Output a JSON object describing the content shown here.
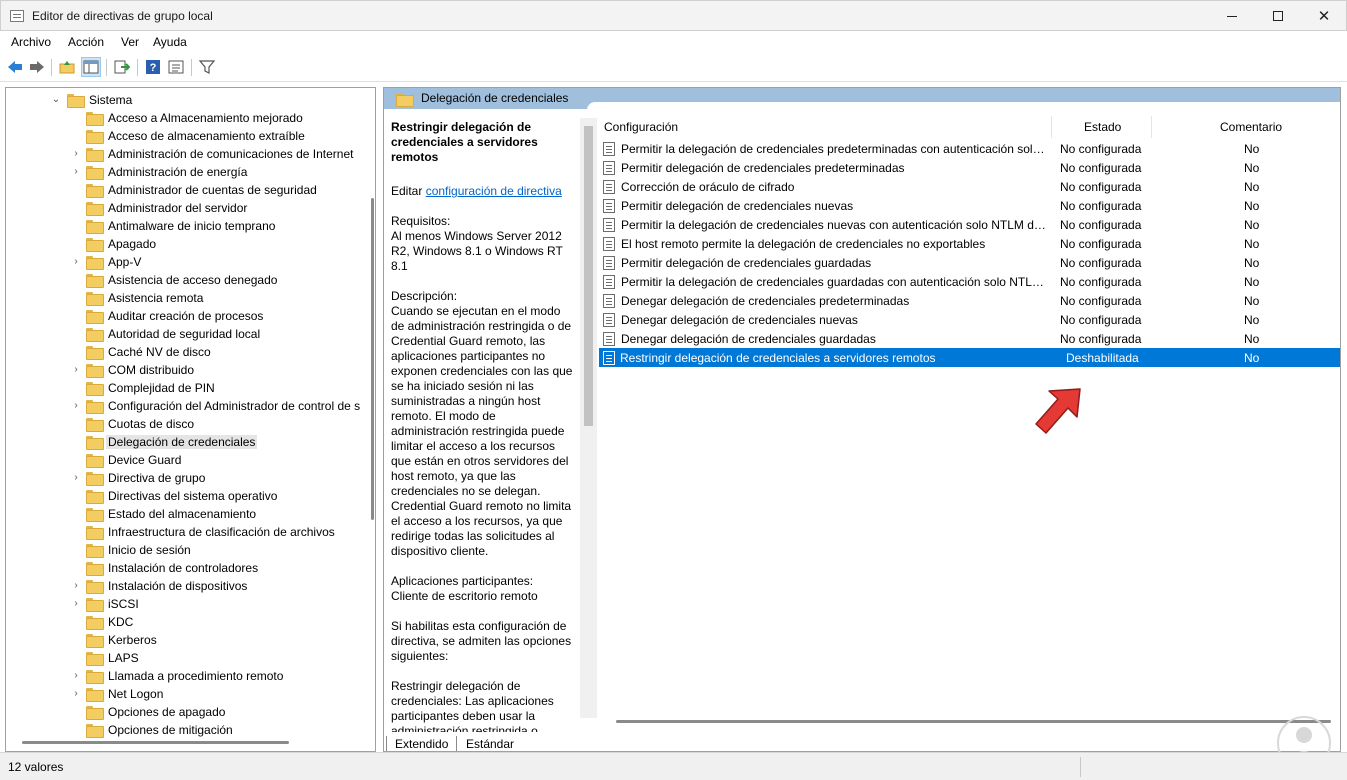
{
  "window": {
    "title": "Editor de directivas de grupo local"
  },
  "menu": [
    "Archivo",
    "Acción",
    "Ver",
    "Ayuda"
  ],
  "toolbar": {
    "buttons": [
      "back-icon",
      "forward-icon",
      "up-folder-icon",
      "show-hide-tree-icon",
      "export-list-icon",
      "help-icon",
      "properties-icon",
      "filter-icon"
    ]
  },
  "tree": {
    "root": "Sistema",
    "items": [
      {
        "label": "Acceso a Almacenamiento mejorado",
        "expandable": false
      },
      {
        "label": "Acceso de almacenamiento extraíble",
        "expandable": false
      },
      {
        "label": "Administración de comunicaciones de Internet",
        "expandable": true
      },
      {
        "label": "Administración de energía",
        "expandable": true
      },
      {
        "label": "Administrador de cuentas de seguridad",
        "expandable": false
      },
      {
        "label": "Administrador del servidor",
        "expandable": false
      },
      {
        "label": "Antimalware de inicio temprano",
        "expandable": false
      },
      {
        "label": "Apagado",
        "expandable": false
      },
      {
        "label": "App-V",
        "expandable": true
      },
      {
        "label": "Asistencia de acceso denegado",
        "expandable": false
      },
      {
        "label": "Asistencia remota",
        "expandable": false
      },
      {
        "label": "Auditar creación de procesos",
        "expandable": false
      },
      {
        "label": "Autoridad de seguridad local",
        "expandable": false
      },
      {
        "label": "Caché NV de disco",
        "expandable": false
      },
      {
        "label": "COM distribuido",
        "expandable": true
      },
      {
        "label": "Complejidad de PIN",
        "expandable": false
      },
      {
        "label": "Configuración del Administrador de control de s",
        "expandable": true
      },
      {
        "label": "Cuotas de disco",
        "expandable": false
      },
      {
        "label": "Delegación de credenciales",
        "expandable": false,
        "selected": true
      },
      {
        "label": "Device Guard",
        "expandable": false
      },
      {
        "label": "Directiva de grupo",
        "expandable": true
      },
      {
        "label": "Directivas del sistema operativo",
        "expandable": false
      },
      {
        "label": "Estado del almacenamiento",
        "expandable": false
      },
      {
        "label": "Infraestructura de clasificación de archivos",
        "expandable": false
      },
      {
        "label": "Inicio de sesión",
        "expandable": false
      },
      {
        "label": "Instalación de controladores",
        "expandable": false
      },
      {
        "label": "Instalación de dispositivos",
        "expandable": true
      },
      {
        "label": "iSCSI",
        "expandable": true
      },
      {
        "label": "KDC",
        "expandable": false
      },
      {
        "label": "Kerberos",
        "expandable": false
      },
      {
        "label": "LAPS",
        "expandable": false
      },
      {
        "label": "Llamada a procedimiento remoto",
        "expandable": true
      },
      {
        "label": "Net Logon",
        "expandable": true
      },
      {
        "label": "Opciones de apagado",
        "expandable": false
      },
      {
        "label": "Opciones de mitigación",
        "expandable": false
      }
    ]
  },
  "panel": {
    "header": "Delegación de credenciales",
    "description": {
      "title": "Restringir delegación de credenciales a servidores remotos",
      "edit_prefix": "Editar ",
      "edit_link": "configuración de directiva",
      "requirements_label": "Requisitos:",
      "requirements": "Al menos Windows Server 2012 R2, Windows 8.1 o Windows RT 8.1",
      "description_label": "Descripción:",
      "description": "Cuando se ejecutan en el modo de administración restringida o de Credential Guard remoto, las aplicaciones participantes no exponen credenciales con las que se ha iniciado sesión ni las suministradas a ningún host remoto. El modo de administración restringida puede limitar el acceso a los recursos que están en otros servidores del host remoto, ya que las credenciales no se delegan. Credential Guard remoto no limita el acceso a los recursos, ya que redirige todas las solicitudes al dispositivo cliente.",
      "apps_label": "Aplicaciones participantes:",
      "apps": "Cliente de escritorio remoto",
      "options_intro": "Si habilitas esta configuración de directiva, se admiten las opciones siguientes:",
      "option_1": "Restringir delegación de credenciales: Las aplicaciones participantes deben usar la administración restringida o Credential Guard remoto para conectarse a los hosts remotos."
    },
    "tabs": [
      "Extendido",
      "Estándar"
    ],
    "columns": [
      "Configuración",
      "Estado",
      "Comentario"
    ],
    "rows": [
      {
        "setting": "Permitir la delegación de credenciales predeterminadas con autenticación solo NTLM de servidor",
        "state": "No configurada",
        "comment": "No"
      },
      {
        "setting": "Permitir delegación de credenciales predeterminadas",
        "state": "No configurada",
        "comment": "No"
      },
      {
        "setting": "Corrección de oráculo de cifrado",
        "state": "No configurada",
        "comment": "No"
      },
      {
        "setting": "Permitir delegación de credenciales nuevas",
        "state": "No configurada",
        "comment": "No"
      },
      {
        "setting": "Permitir la delegación de credenciales nuevas con autenticación solo NTLM de servidor",
        "state": "No configurada",
        "comment": "No"
      },
      {
        "setting": "El host remoto permite la delegación de credenciales no exportables",
        "state": "No configurada",
        "comment": "No"
      },
      {
        "setting": "Permitir delegación de credenciales guardadas",
        "state": "No configurada",
        "comment": "No"
      },
      {
        "setting": "Permitir la delegación de credenciales guardadas con autenticación solo NTLM de servidor",
        "state": "No configurada",
        "comment": "No"
      },
      {
        "setting": "Denegar delegación de credenciales predeterminadas",
        "state": "No configurada",
        "comment": "No"
      },
      {
        "setting": "Denegar delegación de credenciales nuevas",
        "state": "No configurada",
        "comment": "No"
      },
      {
        "setting": "Denegar delegación de credenciales guardadas",
        "state": "No configurada",
        "comment": "No"
      },
      {
        "setting": "Restringir delegación de credenciales a servidores remotos",
        "state": "Deshabilitada",
        "comment": "No",
        "selected": true
      }
    ]
  },
  "status": {
    "text": "12 valores"
  },
  "colors": {
    "selection": "#0078d7",
    "header_band": "#9fbfdd",
    "annotation_arrow": "#e53935"
  }
}
